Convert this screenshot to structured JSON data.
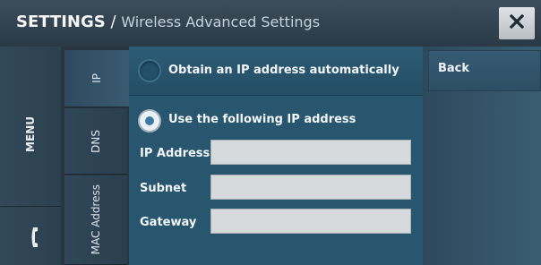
{
  "header": {
    "title_main": "SETTINGS",
    "title_sep": " / ",
    "title_sub": "Wireless Advanced Settings",
    "close_icon": "close-icon"
  },
  "rail": {
    "menu_label": "MENU",
    "phone_icon": "phone-icon"
  },
  "tabs": [
    {
      "label": "IP",
      "active": true
    },
    {
      "label": "DNS",
      "active": false
    },
    {
      "label": "MAC Address",
      "active": false
    }
  ],
  "ip_settings": {
    "option_auto": {
      "label": "Obtain an IP address automatically",
      "selected": false
    },
    "option_manual": {
      "label": "Use the following IP address",
      "selected": true
    },
    "fields": [
      {
        "label": "IP Address",
        "value": ""
      },
      {
        "label": "Subnet",
        "value": ""
      },
      {
        "label": "Gateway",
        "value": ""
      }
    ]
  },
  "actions": {
    "back_label": "Back"
  },
  "colors": {
    "header_bg": "#34444f",
    "panel_bg": "#27566e",
    "input_bg": "#d6dadd",
    "radio_selected_dot": "#3d7aa6"
  }
}
